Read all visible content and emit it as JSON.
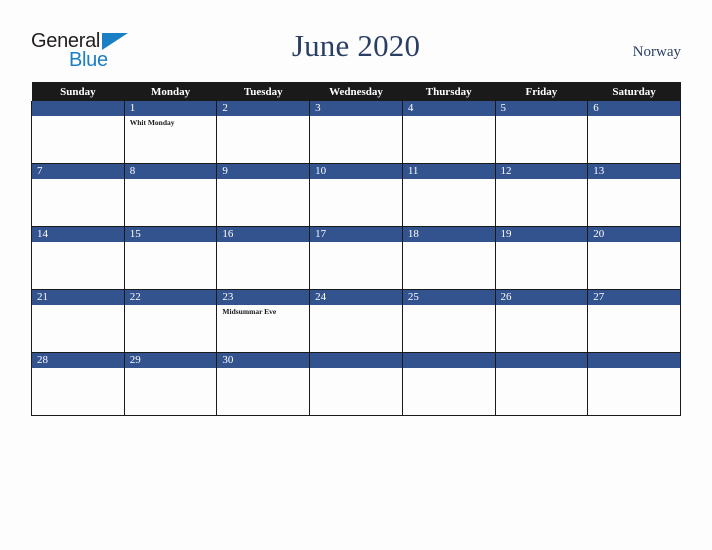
{
  "brand": {
    "name_part1": "General",
    "name_part2": "Blue",
    "triangle_icon": "triangle-icon",
    "accent_color": "#1b7fc3"
  },
  "header": {
    "title": "June 2020",
    "region": "Norway",
    "title_color": "#2a3f63"
  },
  "calendar": {
    "weekday_headers": [
      "Sunday",
      "Monday",
      "Tuesday",
      "Wednesday",
      "Thursday",
      "Friday",
      "Saturday"
    ],
    "header_bg": "#1a1a1a",
    "daybar_bg": "#33538f",
    "weeks": [
      [
        {
          "day": "",
          "events": []
        },
        {
          "day": "1",
          "events": [
            "Whit Monday"
          ]
        },
        {
          "day": "2",
          "events": []
        },
        {
          "day": "3",
          "events": []
        },
        {
          "day": "4",
          "events": []
        },
        {
          "day": "5",
          "events": []
        },
        {
          "day": "6",
          "events": []
        }
      ],
      [
        {
          "day": "7",
          "events": []
        },
        {
          "day": "8",
          "events": []
        },
        {
          "day": "9",
          "events": []
        },
        {
          "day": "10",
          "events": []
        },
        {
          "day": "11",
          "events": []
        },
        {
          "day": "12",
          "events": []
        },
        {
          "day": "13",
          "events": []
        }
      ],
      [
        {
          "day": "14",
          "events": []
        },
        {
          "day": "15",
          "events": []
        },
        {
          "day": "16",
          "events": []
        },
        {
          "day": "17",
          "events": []
        },
        {
          "day": "18",
          "events": []
        },
        {
          "day": "19",
          "events": []
        },
        {
          "day": "20",
          "events": []
        }
      ],
      [
        {
          "day": "21",
          "events": []
        },
        {
          "day": "22",
          "events": []
        },
        {
          "day": "23",
          "events": [
            "Midsummar Eve"
          ]
        },
        {
          "day": "24",
          "events": []
        },
        {
          "day": "25",
          "events": []
        },
        {
          "day": "26",
          "events": []
        },
        {
          "day": "27",
          "events": []
        }
      ],
      [
        {
          "day": "28",
          "events": []
        },
        {
          "day": "29",
          "events": []
        },
        {
          "day": "30",
          "events": []
        },
        {
          "day": "",
          "events": []
        },
        {
          "day": "",
          "events": []
        },
        {
          "day": "",
          "events": []
        },
        {
          "day": "",
          "events": []
        }
      ]
    ]
  }
}
